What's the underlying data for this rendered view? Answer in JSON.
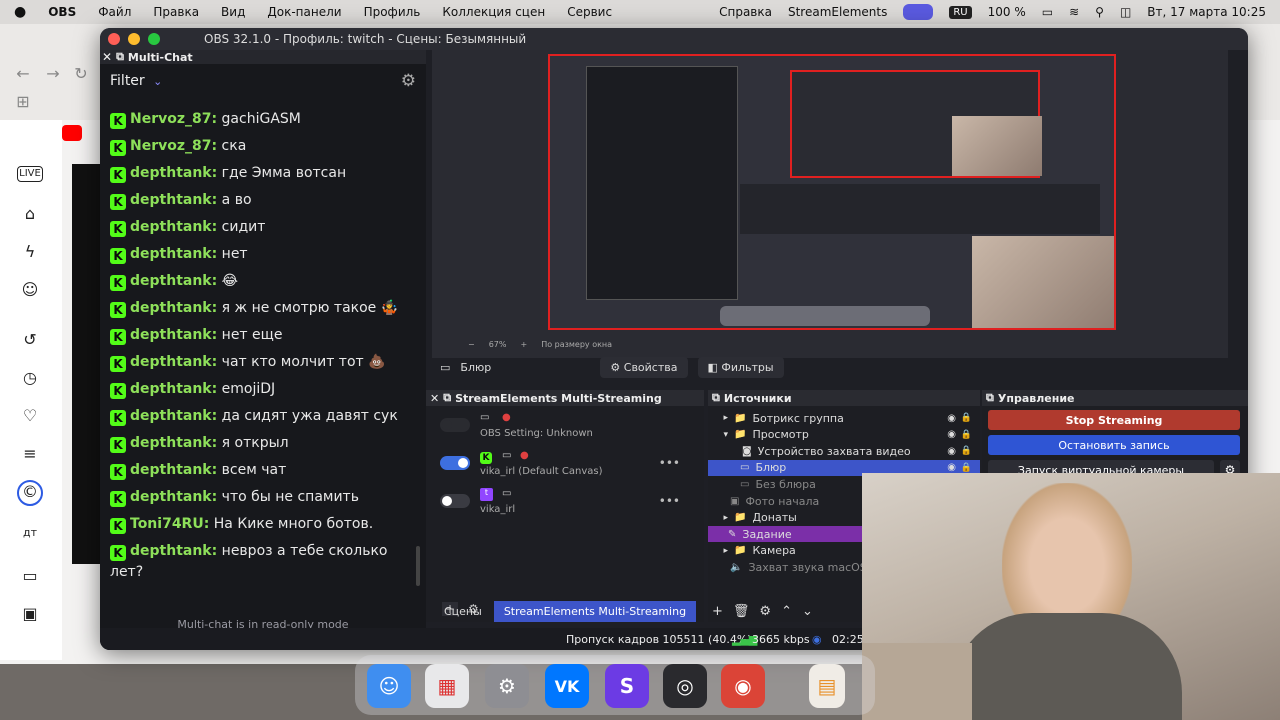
{
  "menubar": {
    "apple_icon": "apple-icon",
    "app_name": "OBS",
    "items": [
      "Файл",
      "Правка",
      "Вид",
      "Док-панели",
      "Профиль",
      "Коллекция сцен",
      "Сервис"
    ],
    "right_items": [
      "Справка",
      "StreamElements"
    ],
    "keyboard_layout": "RU",
    "battery": "100 %",
    "datetime": "Вт, 17 марта  10:25"
  },
  "obs": {
    "title": "OBS 32.1.0 - Профиль: twitch - Сцены: Безымянный",
    "multichat": {
      "header": "Multi-Chat",
      "filter_label": "Filter",
      "messages": [
        {
          "user": "Nervoz_87:",
          "text": " gachiGASM"
        },
        {
          "user": "Nervoz_87:",
          "text": " ска"
        },
        {
          "user": "depthtank:",
          "text": " где Эмма вотсан"
        },
        {
          "user": "depthtank:",
          "text": " а во"
        },
        {
          "user": "depthtank:",
          "text": " сидит"
        },
        {
          "user": "depthtank:",
          "text": " нет"
        },
        {
          "user": "depthtank:",
          "text": " 😂"
        },
        {
          "user": "depthtank:",
          "text": " я ж не смотрю такое 🤹"
        },
        {
          "user": "depthtank:",
          "text": " нет еще"
        },
        {
          "user": "depthtank:",
          "text": " чат кто молчит тот 💩"
        },
        {
          "user": "depthtank:",
          "text": " emojiDJ"
        },
        {
          "user": "depthtank:",
          "text": " да сидят ужа давят сук"
        },
        {
          "user": "depthtank:",
          "text": " я открыл"
        },
        {
          "user": "depthtank:",
          "text": " всем чат"
        },
        {
          "user": "depthtank:",
          "text": " что бы не спамить"
        },
        {
          "user": "Toni74RU:",
          "text": " На Кике много ботов."
        },
        {
          "user": "depthtank:",
          "text": " невроз а тебе сколько лет?"
        }
      ],
      "footer": "Multi-chat is in read-only mode"
    },
    "preview": {
      "zoom": "67%",
      "fit_label": "По размеру окна"
    },
    "source_bar": {
      "source_name": "Блюр",
      "properties_label": "Свойства",
      "filters_label": "Фильтры"
    },
    "se_dock": {
      "title": "StreamElements Multi-Streaming",
      "rows": [
        {
          "label": "OBS Setting: Unknown"
        },
        {
          "label": "vika_irl (Default Canvas)"
        },
        {
          "label": "vika_irl"
        }
      ]
    },
    "sources": {
      "title": "Источники",
      "items": [
        {
          "label": "Ботрикс группа"
        },
        {
          "label": "Просмотр"
        },
        {
          "label": "Устройство захвата видео"
        },
        {
          "label": "Блюр"
        },
        {
          "label": "Без блюра"
        },
        {
          "label": "Фото начала"
        },
        {
          "label": "Донаты"
        },
        {
          "label": "Задание"
        },
        {
          "label": "Камера"
        },
        {
          "label": "Захват звука macOS"
        }
      ]
    },
    "controls": {
      "title": "Управление",
      "stop_streaming": "Stop Streaming",
      "stop_recording": "Остановить запись",
      "virtual_camera": "Запуск виртуальной камеры"
    },
    "tabs": {
      "scenes": "Сцены",
      "se_multistream": "StreamElements Multi-Streaming"
    },
    "status": {
      "dropped_frames": "Пропуск кадров 105511 (40.4%)",
      "bitrate": "3665 kbps",
      "time": "02:25:"
    }
  },
  "colors": {
    "kick_green": "#53fc18",
    "stop_streaming": "#c0392b",
    "stop_recording": "#2f55d4",
    "selection": "#3d55c9",
    "task_purple": "#7b2fa8"
  }
}
